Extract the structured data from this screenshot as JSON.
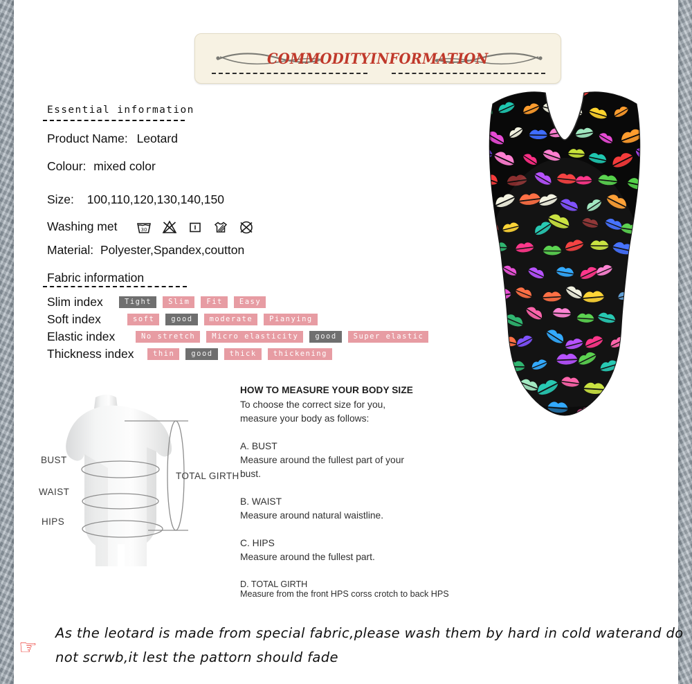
{
  "banner": {
    "title": "COMMODITYINFORMATION"
  },
  "essential": {
    "heading": "Essential information",
    "rows": [
      {
        "label": "Product Name:",
        "value": "Leotard"
      },
      {
        "label": "Colour:",
        "value": "mixed color"
      },
      {
        "label": "Size:",
        "value": "100,110,120,130,140,150"
      },
      {
        "label": "Washing met",
        "value": ""
      },
      {
        "label": "Material:",
        "value": "Polyester,Spandex,coutton"
      }
    ],
    "care_symbols": [
      {
        "name": "wash-30-icon",
        "label": "30"
      },
      {
        "name": "do-not-bleach-icon",
        "label": ""
      },
      {
        "name": "iron-low-icon",
        "label": ""
      },
      {
        "name": "dry-flat-icon",
        "label": ""
      },
      {
        "name": "do-not-tumble-dry-icon",
        "label": ""
      }
    ]
  },
  "fabric": {
    "heading": "Fabric information",
    "rows": [
      {
        "label": "Slim index",
        "tags": [
          {
            "text": "Tight",
            "selected": true
          },
          {
            "text": "Slim",
            "selected": false
          },
          {
            "text": "Fit",
            "selected": false
          },
          {
            "text": "Easy",
            "selected": false
          }
        ]
      },
      {
        "label": "Soft index",
        "tags": [
          {
            "text": "soft",
            "selected": false
          },
          {
            "text": "good",
            "selected": true
          },
          {
            "text": "moderate",
            "selected": false
          },
          {
            "text": "Pianying",
            "selected": false
          }
        ]
      },
      {
        "label": "Elastic index",
        "tags": [
          {
            "text": "No stretch",
            "selected": false
          },
          {
            "text": "Micro elasticity",
            "selected": false
          },
          {
            "text": "good",
            "selected": true
          },
          {
            "text": "Super elastic",
            "selected": false
          }
        ]
      },
      {
        "label": "Thickness index",
        "tags": [
          {
            "text": "thin",
            "selected": false
          },
          {
            "text": "good",
            "selected": true
          },
          {
            "text": "thick",
            "selected": false
          },
          {
            "text": "thickening",
            "selected": false
          }
        ]
      }
    ]
  },
  "mannequin": {
    "bust_label": "BUST",
    "waist_label": "WAIST",
    "hips_label": "HIPS",
    "total_girth_label": "TOTAL GIRTH"
  },
  "measure": {
    "title": "HOW TO MEASURE YOUR BODY SIZE",
    "intro_line1": "To choose the correct size for you,",
    "intro_line2": "measure your body as follows:",
    "items": [
      {
        "head": "A. BUST",
        "line1": "Measure around the fullest part of your",
        "line2": "bust."
      },
      {
        "head": "B. WAIST",
        "line1": "Measure around natural waistline.",
        "line2": ""
      },
      {
        "head": "C. HIPS",
        "line1": "Measure around the fullest part.",
        "line2": ""
      },
      {
        "head": "D. TOTAL GIRTH",
        "line1": "Measure from the front HPS corss crotch to back HPS",
        "line2": ""
      }
    ]
  },
  "note": {
    "icon": "pointing-hand-icon",
    "line1": "As the leotard is made from special fabric,please wash them by hard in cold waterand do",
    "line2": "not scrwb,it lest the pattorn should fade"
  },
  "product_image": {
    "name": "leotard-photo",
    "garment_color": "#0a0a0a",
    "pattern": "multicolor-lips"
  },
  "colors": {
    "banner_bg": "#f7f2e3",
    "banner_title": "#c0392b",
    "tag_default": "#e79ca3",
    "tag_selected": "#6f6f6f",
    "note_icon": "#e8221b",
    "edge": "#9aa5ae"
  }
}
